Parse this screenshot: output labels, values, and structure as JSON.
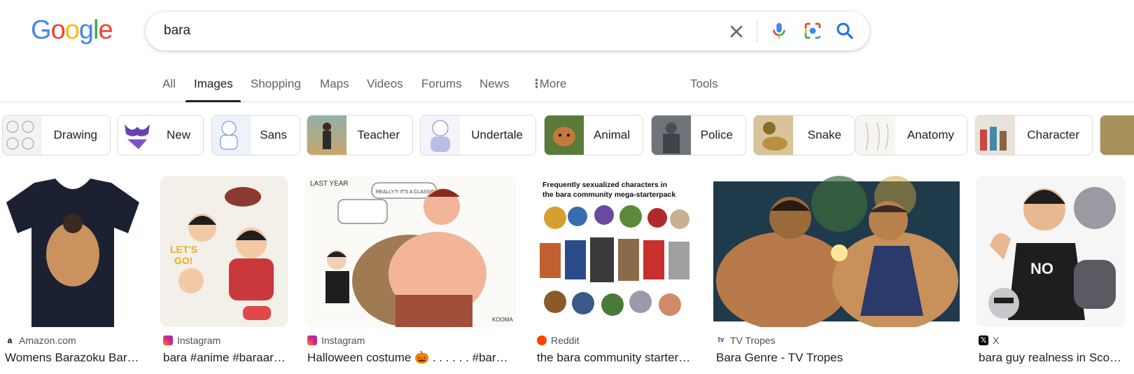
{
  "logo": {
    "letters": [
      "G",
      "o",
      "o",
      "g",
      "l",
      "e"
    ],
    "colors": [
      "#4285F4",
      "#EA4335",
      "#FBBC05",
      "#4285F4",
      "#34A853",
      "#EA4335"
    ]
  },
  "search": {
    "query": "bara"
  },
  "tabs": [
    {
      "label": "All"
    },
    {
      "label": "Images"
    },
    {
      "label": "Shopping"
    },
    {
      "label": "Maps"
    },
    {
      "label": "Videos"
    },
    {
      "label": "Forums"
    },
    {
      "label": "News"
    },
    {
      "label": "More"
    },
    {
      "label": "Tools"
    }
  ],
  "active_tab": "Images",
  "chips": [
    {
      "label": "Drawing"
    },
    {
      "label": "New"
    },
    {
      "label": "Sans"
    },
    {
      "label": "Teacher"
    },
    {
      "label": "Undertale"
    },
    {
      "label": "Animal"
    },
    {
      "label": "Police"
    },
    {
      "label": "Snake"
    },
    {
      "label": "Anatomy"
    },
    {
      "label": "Character"
    }
  ],
  "results": [
    {
      "source": "Amazon.com",
      "title": "Womens Barazoku Bar…",
      "favicon": "amazon-icon"
    },
    {
      "source": "Instagram",
      "title": "bara #anime #baraar…",
      "favicon": "instagram-icon"
    },
    {
      "source": "Instagram",
      "title": "Halloween costume 🎃 . . . . . . #bar…",
      "favicon": "instagram-icon"
    },
    {
      "source": "Reddit",
      "title": "the bara community starter…",
      "favicon": "reddit-icon"
    },
    {
      "source": "TV Tropes",
      "title": "Bara Genre - TV Tropes",
      "favicon": "tvtropes-icon"
    },
    {
      "source": "X",
      "title": "bara guy realness in Sco…",
      "favicon": "x-icon"
    }
  ],
  "result_images": [
    {
      "text_lines": []
    },
    {
      "text_lines": [
        "LET'S",
        "GO!"
      ]
    },
    {
      "text_lines": [
        "LAST YEAR",
        "REALLY?! IT'S A CLASSIC!",
        "KOOMA"
      ]
    },
    {
      "text_lines": [
        "Frequently sexualized characters in",
        "the bara community mega-starterpack"
      ]
    },
    {
      "text_lines": []
    },
    {
      "text_lines": [
        "NO"
      ]
    }
  ],
  "colors": {
    "accent": "#1a73e8",
    "border": "#dadce0",
    "muted": "#5f6368"
  }
}
